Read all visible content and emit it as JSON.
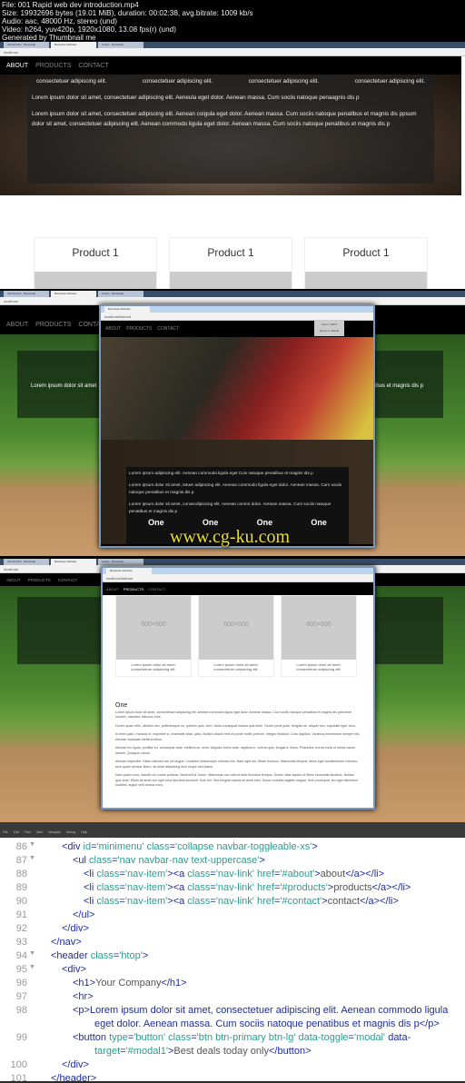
{
  "meta": {
    "lines": [
      "File: 001 Rapid web dev introduction.mp4",
      "Size: 19932696 bytes (19.01 MiB), duration: 00:02:38, avg.bitrate: 1009 kb/s",
      "Audio: aac, 48000 Hz, stereo (und)",
      "Video: h264, yuv420p, 1920x1080, 13.08 fps(r) (und)",
      "Generated by Thumbnail me"
    ]
  },
  "browser": {
    "tabs": [
      "Introduction · Bootstrap",
      "Bootstrap Website",
      "Colors · Bootstrap"
    ],
    "address": "localhost",
    "address2": "localhost/#about"
  },
  "site": {
    "nav": [
      "ABOUT",
      "PRODUCTS",
      "CONTACT"
    ],
    "short": "Lorem ipsum dolor sit amet,",
    "short2": "consectetuer adipiscing elit.",
    "p1": "Lorem ipsum dolor sit amet, consectetuer adipiscing elit. Aeneula eget dolor. Aenean massa. Cum sociis natoque penaagnis dis p",
    "p2": "Lorem ipsum dolor sit amet, consectetuer adipiscing elit. Aenean coigula eget dolor. Aenean massa. Cum sociis natoque penatibus et magnis dis ppsum dolor sit amet, consectetuer adipiscing elit. Aenean commodo ligula eget dolor. Aenean massa. Cum sociis natoque penatibus et magnis dis p",
    "product": "Product 1",
    "hero2_left": "Lorem ipsum dolor sit amet",
    "hero2_right": "tibus et magnis dis p",
    "zoom": "Zoom: 125%",
    "reset": "Reset to default",
    "pp": [
      "Lorem ipsum adipiscing elit. Aenean commodo ligula eget Ccis natoque penatibus et magnis dis p",
      "Lorem ipsum dolor sit amet, tetuer adipiscing elit. Aenean commodo ligula eget dolor. Aenean massa. Cum sociis natoque penatibus et magnis dis p",
      "Lorem ipsum dolor sit amet, consecdipiscing elit. Aenean commt dolor. Aenean massa. Cum sociis natoque penatibus et magnis dis p"
    ],
    "one": "One",
    "placeholder": "600×600",
    "caption": "Lorem ipsum dolor sit amet, consectetuer adipiscing elit.",
    "section_paras": [
      "Lorem ipsum dolor sit amet, consectetuer adipiscing elit. Aenean commodo ligula eget dolor. Aenean massa. Cum sociis natoque penatibus et magnis dis parturient montes, nascetur ridiculus mus.",
      "Donec quam felis, ultricies nec, pellentesque eu, pretium quis, sem. Nulla consequat massa quis enim. Donec pede justo, fringilla vel, aliquet nec, vulputate eget, arcu.",
      "In enim justo, rhoncus ut, imperdiet a, venenatis vitae, justo. Nullam dictum felis eu pede mollis pretium. Integer tincidunt. Cras dapibus. Vivamus elementum semper nisi. Aenean vulputate eleifend tellus.",
      "Aenean leo ligula, porttitor eu, consequat vitae, eleifend ac, enim. Aliquam lorem ante, dapibus in, viverra quis, feugiat a, tellus. Phasellus viverra nulla ut metus varius laoreet. Quisque rutrum.",
      "Aenean imperdiet. Etiam ultricies nisi vel augue. Curabitur ullamcorper ultricies nisi. Nam eget dui. Etiam rhoncus. Maecenas tempus, tellus eget condimentum rhoncus, sem quam semper libero, sit amet adipiscing sem neque sed ipsum.",
      "Nam quam nunc, blandit vel, luctus pulvinar, hendrerit id, lorem. Maecenas nec odio et ante tincidunt tempus. Donec vitae sapien ut libero venenatis faucibus. Nullam quis ante. Etiam sit amet orci eget eros faucibus tincidunt. Duis leo. Sed fringilla mauris sit amet nibh. Donec sodales sagittis magna. Sed consequat, leo eget bibendum sodales, augue velit cursus nunc."
    ]
  },
  "editor": {
    "menu": [
      "File",
      "Edit",
      "Find",
      "View",
      "Navigate",
      "Debug",
      "Help"
    ],
    "lines": [
      {
        "n": "86",
        "html": "<div id='minimenu' class='collapse navbar-toggleable-xs'>",
        "indent": 2
      },
      {
        "n": "87",
        "html": "<ul class='nav navbar-nav text-uppercase'>",
        "indent": 3
      },
      {
        "n": "88",
        "html": "<li class='nav-item'><a class='nav-link' href='#about'>about</a></li>",
        "indent": 4
      },
      {
        "n": "89",
        "html": "<li class='nav-item'><a class='nav-link' href='#products'>products</a></li>",
        "indent": 4
      },
      {
        "n": "90",
        "html": "<li class='nav-item'><a class='nav-link' href='#contact'>contact</a></li>",
        "indent": 4
      },
      {
        "n": "91",
        "html": "</ul>",
        "indent": 3
      },
      {
        "n": "92",
        "html": "</div>",
        "indent": 2
      },
      {
        "n": "93",
        "html": "</nav>",
        "indent": 1
      },
      {
        "n": "94",
        "html": "<header class='htop'>",
        "indent": 1
      },
      {
        "n": "95",
        "html": "<div>",
        "indent": 2
      },
      {
        "n": "96",
        "html": "<h1>Your Company</h1>",
        "indent": 3
      },
      {
        "n": "97",
        "html": "<hr>",
        "indent": 3
      },
      {
        "n": "98",
        "html": "<p>Lorem ipsum dolor sit amet, consectetuer adipiscing elit. Aenean commodo ligula",
        "indent": 3
      },
      {
        "n": "",
        "html": "eget dolor. Aenean massa. Cum sociis natoque penatibus et magnis dis p</p>",
        "indent": 5
      },
      {
        "n": "99",
        "html": "<button type='button' class='btn btn-primary btn-lg' data-toggle='modal' data-",
        "indent": 3
      },
      {
        "n": "",
        "html": "target='#modal1'>Best deals today only</button>",
        "indent": 5
      },
      {
        "n": "100",
        "html": "</div>",
        "indent": 2
      },
      {
        "n": "101",
        "html": "</header>",
        "indent": 1
      }
    ]
  },
  "watermark": "www.cg-ku.com",
  "colors": {
    "tag": "#1e2d9e",
    "attr_value": "#2a9d8f",
    "text": "#555555",
    "tab_bar": "#3a4e6a"
  }
}
